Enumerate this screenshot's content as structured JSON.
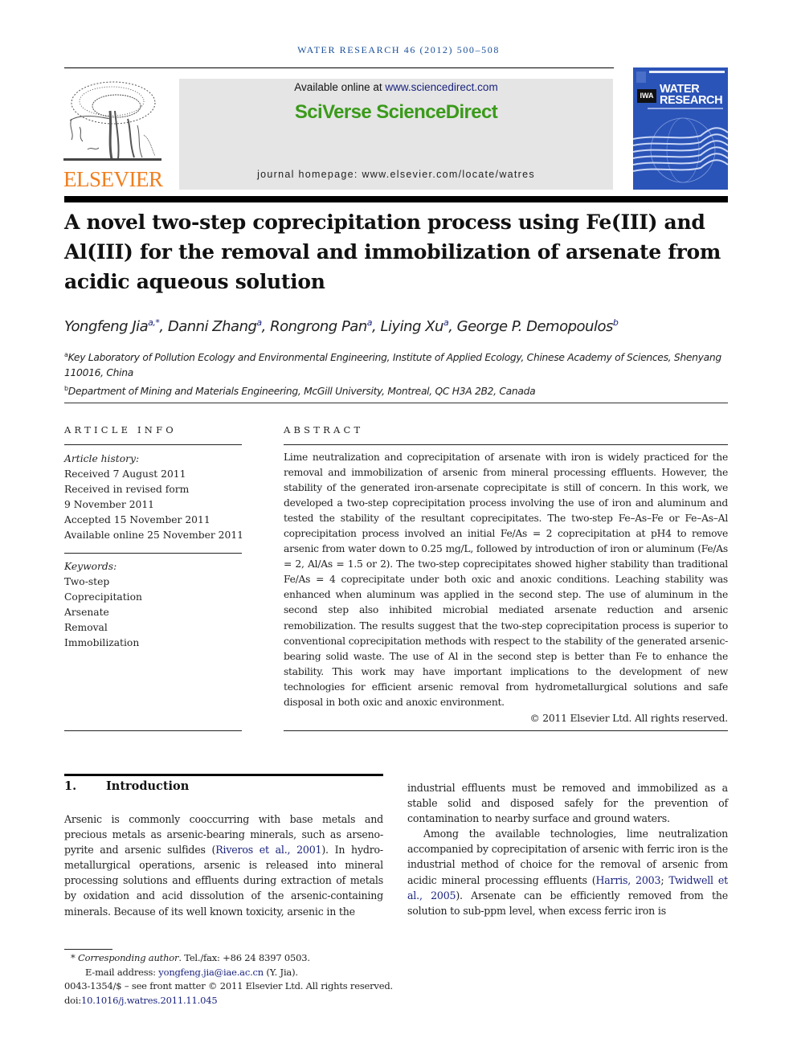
{
  "running_head": "WATER RESEARCH 46 (2012) 500–508",
  "publisher": {
    "logo_word": "ELSEVIER",
    "logo_icon": "elsevier-tree-icon",
    "color": "#f07e1e"
  },
  "sciencedirect": {
    "available_prefix": "Available online at ",
    "available_link": "www.sciencedirect.com",
    "brand": "SciVerse ScienceDirect",
    "brand_color": "#3a9a1a",
    "homepage_prefix": "journal homepage: ",
    "homepage_url": "www.elsevier.com/locate/watres"
  },
  "journal_cover": {
    "badge": "IWA",
    "title_line1": "WATER",
    "title_line2": "RESEARCH",
    "color": "#2b54b8"
  },
  "article": {
    "title": "A novel two-step coprecipitation process using Fe(III) and Al(III) for the removal and immobilization of arsenate from acidic aqueous solution",
    "authors": [
      {
        "name": "Yongfeng Jia",
        "sup": "a,*"
      },
      {
        "name": "Danni Zhang",
        "sup": "a"
      },
      {
        "name": "Rongrong Pan",
        "sup": "a"
      },
      {
        "name": "Liying Xu",
        "sup": "a"
      },
      {
        "name": "George P. Demopoulos",
        "sup": "b"
      }
    ],
    "affiliations": [
      {
        "mark": "a",
        "text": "Key Laboratory of Pollution Ecology and Environmental Engineering, Institute of Applied Ecology, Chinese Academy of Sciences, Shenyang 110016, China"
      },
      {
        "mark": "b",
        "text": "Department of Mining and Materials Engineering, McGill University, Montreal, QC H3A 2B2, Canada"
      }
    ]
  },
  "article_info": {
    "heading": "ARTICLE INFO",
    "history_label": "Article history:",
    "history": [
      "Received 7 August 2011",
      "Received in revised form",
      "9 November 2011",
      "Accepted 15 November 2011",
      "Available online 25 November 2011"
    ],
    "keywords_label": "Keywords:",
    "keywords": [
      "Two-step",
      "Coprecipitation",
      "Arsenate",
      "Removal",
      "Immobilization"
    ]
  },
  "abstract": {
    "heading": "ABSTRACT",
    "text": "Lime neutralization and coprecipitation of arsenate with iron is widely practiced for the removal and immobilization of arsenic from mineral processing effluents. However, the stability of the generated iron-arsenate coprecipitate is still of concern. In this work, we developed a two-step coprecipitation process involving the use of iron and aluminum and tested the stability of the resultant coprecipitates. The two-step Fe–As–Fe or Fe–As–Al coprecipitation process involved an initial Fe/As = 2 coprecipitation at pH4 to remove arsenic from water down to 0.25 mg/L, followed by introduction of iron or aluminum (Fe/As = 2, Al/As = 1.5 or 2). The two-step coprecipitates showed higher stability than traditional Fe/As = 4 coprecipitate under both oxic and anoxic conditions. Leaching stability was enhanced when aluminum was applied in the second step. The use of aluminum in the second step also inhibited microbial mediated arsenate reduction and arsenic remobilization. The results suggest that the two-step coprecipitation process is superior to conventional coprecipitation methods with respect to the stability of the generated arsenic-bearing solid waste. The use of Al in the second step is better than Fe to enhance the stability. This work may have important implications to the development of new technologies for efficient arsenic removal from hydrometallurgical solutions and safe disposal in both oxic and anoxic environment.",
    "copyright": "© 2011 Elsevier Ltd. All rights reserved."
  },
  "introduction": {
    "number": "1.",
    "heading": "Introduction",
    "left_p1_a": "Arsenic is commonly cooccurring with base metals and precious metals as arsenic-bearing minerals, such as arseno-pyrite and arsenic sulfides (",
    "left_p1_ref": "Riveros et al., 2001",
    "left_p1_b": "). In hydro-metallurgical operations, arsenic is released into mineral processing solutions and effluents during extraction of metals by oxidation and acid dissolution of the arsenic-containing minerals. Because of its well known toxicity, arsenic in the",
    "right_p1": "industrial effluents must be removed and immobilized as a stable solid and disposed safely for the prevention of contamination to nearby surface and ground waters.",
    "right_p2_a": "Among the available technologies, lime neutralization accompanied by coprecipitation of arsenic with ferric iron is the industrial method of choice for the removal of arsenic from acidic mineral processing effluents (",
    "right_p2_ref1": "Harris, 2003",
    "right_p2_sep": "; ",
    "right_p2_ref2": "Twidwell et al., 2005",
    "right_p2_b": "). Arsenate can be efficiently removed from the solution to sub-ppm level, when excess ferric iron is"
  },
  "footnotes": {
    "star": "*",
    "corr_label": "Corresponding author",
    "corr_rest": ". Tel./fax: +86 24 8397 0503.",
    "email_label": "E-mail address: ",
    "email": "yongfeng.jia@iae.ac.cn",
    "email_suffix": " (Y. Jia).",
    "issn_line": "0043-1354/$ – see front matter © 2011 Elsevier Ltd. All rights reserved.",
    "doi_label": "doi:",
    "doi": "10.1016/j.watres.2011.11.045"
  }
}
